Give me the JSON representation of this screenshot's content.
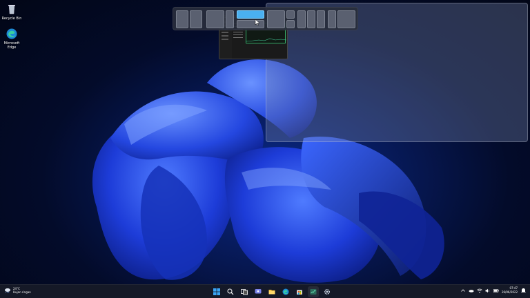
{
  "desktop": {
    "icons": [
      {
        "label": "Recycle Bin"
      },
      {
        "label": "Microsoft Edge"
      }
    ]
  },
  "snap_flyout": {
    "layouts": 6,
    "active_zone": "layout-3-top"
  },
  "app_window": {
    "title": "Task Manager"
  },
  "taskbar": {
    "weather": {
      "temp": "24°C",
      "condition": "Hujan ringan"
    },
    "clock": {
      "time": "07:47",
      "date": "26/06/2022"
    },
    "icons": [
      "start-icon",
      "search-icon",
      "task-view-icon",
      "chat-icon",
      "file-explorer-icon",
      "edge-icon",
      "store-icon",
      "task-manager-icon",
      "settings-icon"
    ]
  }
}
